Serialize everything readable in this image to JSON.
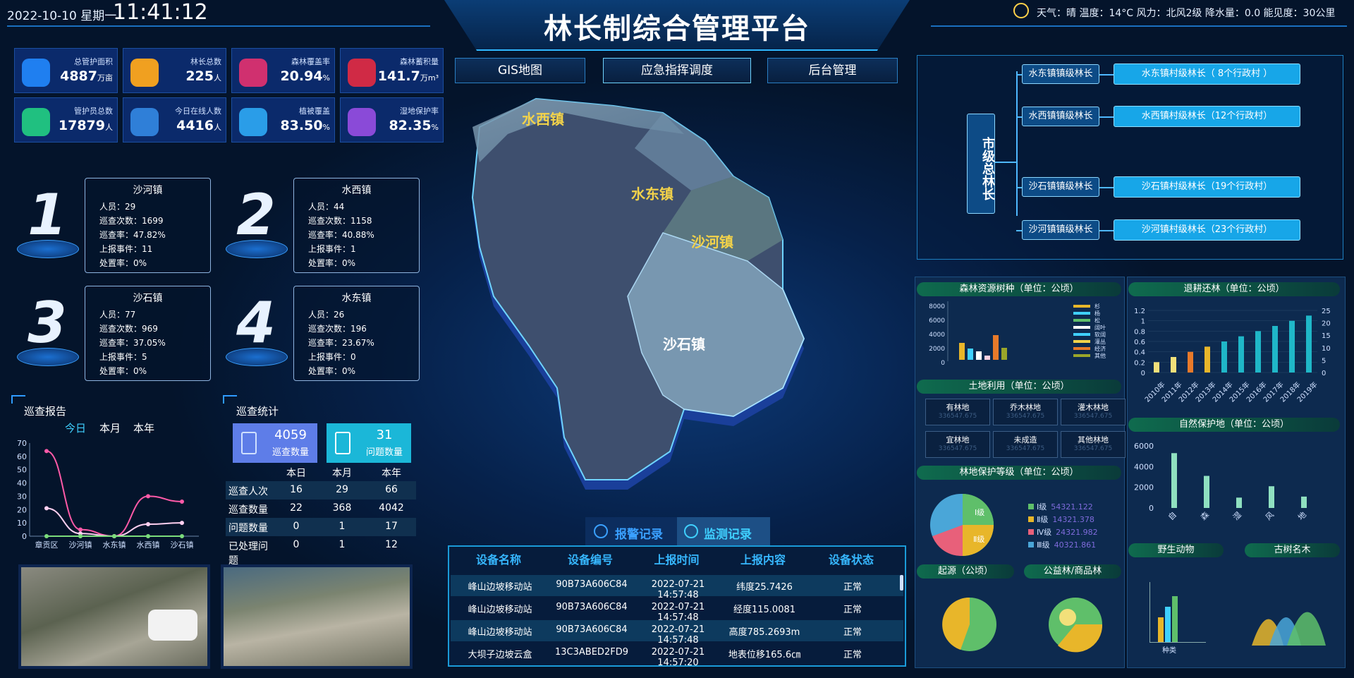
{
  "header": {
    "date": "2022-10-10 星期一",
    "time": "11:41:12",
    "title": "林长制综合管理平台",
    "weather": "天气：晴  温度：14°C  风力：北风2级  降水量：0.0  能见度：30公里"
  },
  "nav": {
    "gis": "GIS地图",
    "emergency": "应急指挥调度",
    "backend": "后台管理"
  },
  "stats": [
    {
      "label": "总管护面积",
      "value": "4887",
      "unit": "万亩",
      "color": "#1f7ff0"
    },
    {
      "label": "林长总数",
      "value": "225",
      "unit": "人",
      "color": "#f0a020"
    },
    {
      "label": "森林覆盖率",
      "value": "20.94",
      "unit": "%",
      "color": "#d0306f"
    },
    {
      "label": "森林蓄积量",
      "value": "141.7",
      "unit": "万m³",
      "color": "#d02a45"
    },
    {
      "label": "管护员总数",
      "value": "17879",
      "unit": "人",
      "color": "#20c080"
    },
    {
      "label": "今日在线人数",
      "value": "4416",
      "unit": "人",
      "color": "#2f7fd8"
    },
    {
      "label": "植被覆盖",
      "value": "83.50",
      "unit": "%",
      "color": "#2a9de8"
    },
    {
      "label": "湿地保护率",
      "value": "82.35",
      "unit": "%",
      "color": "#8a4ad8"
    }
  ],
  "towns": [
    {
      "rank": "1",
      "name": "沙河镇",
      "people": "人员：29",
      "count": "巡查次数：1699",
      "rate": "巡查率：47.82%",
      "events": "上报事件：11",
      "handle": "处置率：0%"
    },
    {
      "rank": "2",
      "name": "水西镇",
      "people": "人员：44",
      "count": "巡查次数：1158",
      "rate": "巡查率：40.88%",
      "events": "上报事件：1",
      "handle": "处置率：0%"
    },
    {
      "rank": "3",
      "name": "沙石镇",
      "people": "人员：77",
      "count": "巡查次数：969",
      "rate": "巡查率：37.05%",
      "events": "上报事件：5",
      "handle": "处置率：0%"
    },
    {
      "rank": "4",
      "name": "水东镇",
      "people": "人员：26",
      "count": "巡查次数：196",
      "rate": "巡查率：23.67%",
      "events": "上报事件：0",
      "handle": "处置率：0%"
    }
  ],
  "patrol_report": {
    "title": "巡查报告",
    "tabs": [
      "今日",
      "本月",
      "本年"
    ]
  },
  "patrol_stats": {
    "title": "巡查统计",
    "count_value": "4059",
    "count_label": "巡查数量",
    "issue_value": "31",
    "issue_label": "问题数量",
    "cols": [
      "本日",
      "本月",
      "本年"
    ],
    "rows": [
      {
        "label": "巡查人次",
        "v": [
          "16",
          "29",
          "66"
        ]
      },
      {
        "label": "巡查数量",
        "v": [
          "22",
          "368",
          "4042"
        ]
      },
      {
        "label": "问题数量",
        "v": [
          "0",
          "1",
          "17"
        ]
      },
      {
        "label": "已处理问题",
        "v": [
          "0",
          "1",
          "12"
        ]
      }
    ]
  },
  "map_labels": {
    "shuixi": "水西镇",
    "shuidong": "水东镇",
    "shahe": "沙河镇",
    "shashi": "沙石镇"
  },
  "device": {
    "tab_alarm": "报警记录",
    "tab_monitor": "监测记录",
    "headers": [
      "设备名称",
      "设备编号",
      "上报时间",
      "上报内容",
      "设备状态"
    ],
    "rows": [
      [
        "峰山边坡移动站",
        "90B73A606C84",
        "2022-07-21 14:57:48",
        "纬度25.7426",
        "正常"
      ],
      [
        "峰山边坡移动站",
        "90B73A606C84",
        "2022-07-21 14:57:48",
        "经度115.0081",
        "正常"
      ],
      [
        "峰山边坡移动站",
        "90B73A606C84",
        "2022-07-21 14:57:48",
        "高度785.2693m",
        "正常"
      ],
      [
        "大坝子边坡云盒",
        "13C3ABED2FD9",
        "2022-07-21 14:57:20",
        "地表位移165.6㎝",
        "正常"
      ]
    ]
  },
  "org": {
    "root": "市级总林长",
    "towns": [
      "水东镇镇级林长",
      "水西镇镇级林长",
      "沙石镇镇级林长",
      "沙河镇镇级林长"
    ],
    "villages": [
      "水东镇村级林长（ 8个行政村 ）",
      "水西镇村级林长（12个行政村）",
      "沙石镇村级林长（19个行政村）",
      "沙河镇村级林长（23个行政村）"
    ]
  },
  "panels": {
    "tree_species": "森林资源树种（单位：公顷）",
    "land_use": "土地利用（单位：公顷）",
    "forest_protect": "林地保护等级（单位：公顷）",
    "origin": "起源（公顷）",
    "public_forest": "公益林/商品林",
    "return_forest": "退耕还林（单位：公顷）",
    "nature_reserve": "自然保护地（单位：公顷）",
    "wildlife": "野生动物",
    "old_trees": "古树名木",
    "land_items": [
      {
        "name": "有林地",
        "val": "336547.675"
      },
      {
        "name": "乔木林地",
        "val": "336547.675"
      },
      {
        "name": "灌木林地",
        "val": "336547.675"
      },
      {
        "name": "宜林地",
        "val": "336547.675"
      },
      {
        "name": "未成造",
        "val": "336547.675"
      },
      {
        "name": "其他林地",
        "val": "336547.675"
      }
    ],
    "protect_legend": [
      {
        "name": "Ⅰ级",
        "val": "54321.122",
        "color": "#5fbf6a"
      },
      {
        "name": "Ⅱ级",
        "val": "14321.378",
        "color": "#e8b62a"
      },
      {
        "name": "Ⅳ级",
        "val": "24321.982",
        "color": "#e8607a"
      },
      {
        "name": "Ⅲ级",
        "val": "40321.861",
        "color": "#4aa6d8"
      }
    ],
    "pie_labels": {
      "p1": "Ⅰ级",
      "p2": "Ⅱ级"
    },
    "wild_x": "种类",
    "species_legend": [
      "杉",
      "杨",
      "松",
      "阔叶",
      "软阔",
      "灌丛",
      "经济",
      "其他"
    ]
  },
  "chart_data": [
    {
      "type": "line",
      "title": "巡查报告",
      "categories": [
        "章贡区",
        "沙河镇",
        "水东镇",
        "水西镇",
        "沙石镇"
      ],
      "ylim": [
        0,
        70
      ],
      "yticks": [
        0,
        10,
        20,
        30,
        40,
        50,
        60,
        70
      ],
      "series": [
        {
          "values": [
            64,
            5,
            0,
            30,
            26
          ],
          "color": "#ff5aa8"
        },
        {
          "values": [
            21,
            2,
            0,
            9,
            10
          ],
          "color": "#ffd0f0"
        },
        {
          "values": [
            0,
            0,
            0,
            0,
            0
          ],
          "color": "#7bdc7b"
        }
      ]
    },
    {
      "type": "bar",
      "title": "退耕还林（单位：公顷）",
      "categories": [
        "2010年",
        "2011年",
        "2012年",
        "2013年",
        "2014年",
        "2015年",
        "2016年",
        "2017年",
        "2018年",
        "2019年"
      ],
      "values": [
        0.2,
        0.3,
        0.4,
        0.5,
        0.6,
        0.7,
        0.8,
        0.9,
        1.0,
        1.1
      ],
      "ylim": [
        0,
        1.2
      ],
      "yticks": [
        "0",
        "0.2",
        "0.4",
        "0.6",
        "0.8",
        "1",
        "1.2"
      ],
      "y2ticks": [
        "0",
        "5",
        "10",
        "15",
        "20",
        "25"
      ]
    },
    {
      "type": "bar",
      "title": "自然保护地（单位：公顷）",
      "categories": [
        "自",
        "森",
        "湿",
        "风",
        "地"
      ],
      "values": [
        5300,
        3100,
        1000,
        2100,
        1100
      ],
      "ylim": [
        0,
        6000
      ],
      "yticks": [
        "0",
        "2000",
        "4000",
        "6000"
      ]
    }
  ]
}
